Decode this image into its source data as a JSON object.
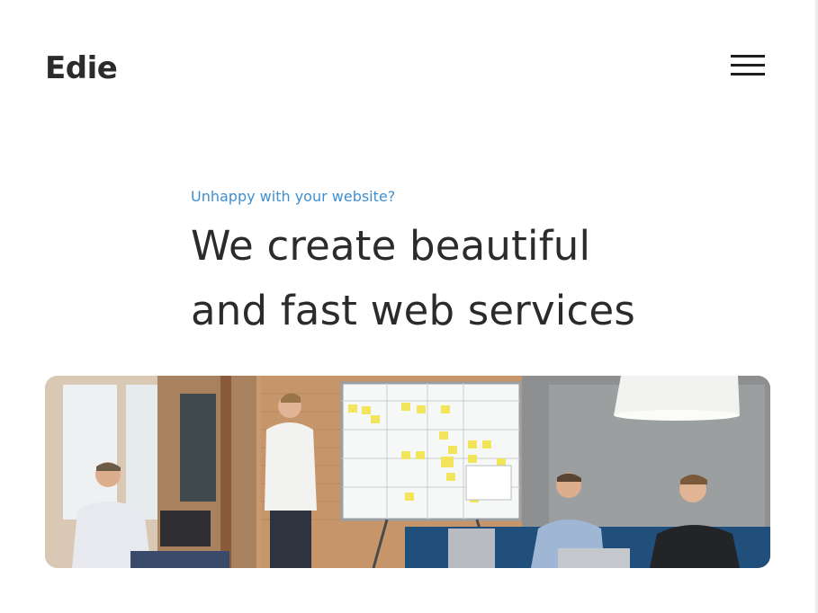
{
  "header": {
    "logo_text": "Edie",
    "menu_icon": "hamburger-menu-icon"
  },
  "hero": {
    "eyebrow": "Unhappy with your website?",
    "headline_line1": "We create beautiful",
    "headline_line2": "and fast web services"
  },
  "colors": {
    "accent": "#3f8fcf",
    "text": "#2b2b2b",
    "background": "#ffffff"
  }
}
